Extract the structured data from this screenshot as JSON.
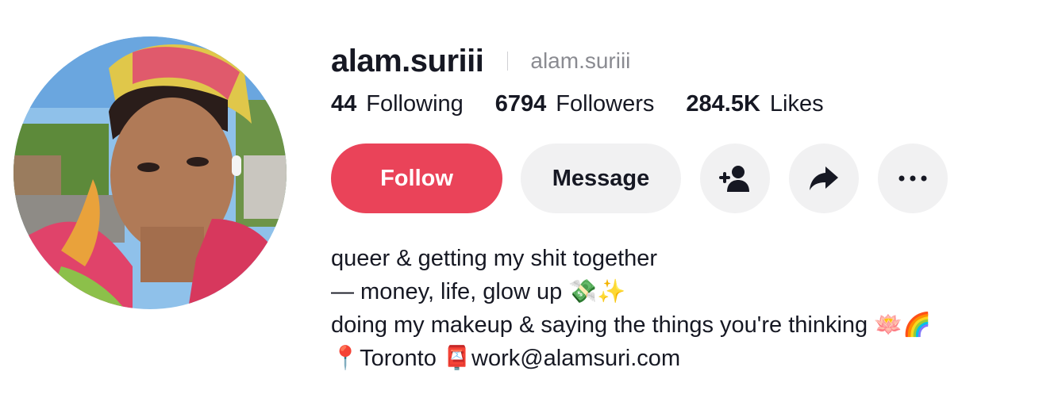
{
  "profile": {
    "username": "alam.suriii",
    "nickname": "alam.suriii"
  },
  "stats": {
    "following_count": "44",
    "following_label": "Following",
    "followers_count": "6794",
    "followers_label": "Followers",
    "likes_count": "284.5K",
    "likes_label": "Likes"
  },
  "actions": {
    "follow_label": "Follow",
    "message_label": "Message",
    "add_friend_icon": "add-user-icon",
    "share_icon": "share-icon",
    "more_icon": "more-icon"
  },
  "bio": {
    "line1": "queer & getting my shit together",
    "line2": "— money, life, glow up 💸✨",
    "line3": "doing my makeup & saying the things you're thinking 🪷🌈",
    "line4": "📍Toronto 📮work@alamsuri.com"
  },
  "colors": {
    "follow_button": "#ea4359",
    "secondary_button": "#f1f1f2",
    "text_primary": "#161823",
    "text_secondary": "#8a8b91"
  }
}
